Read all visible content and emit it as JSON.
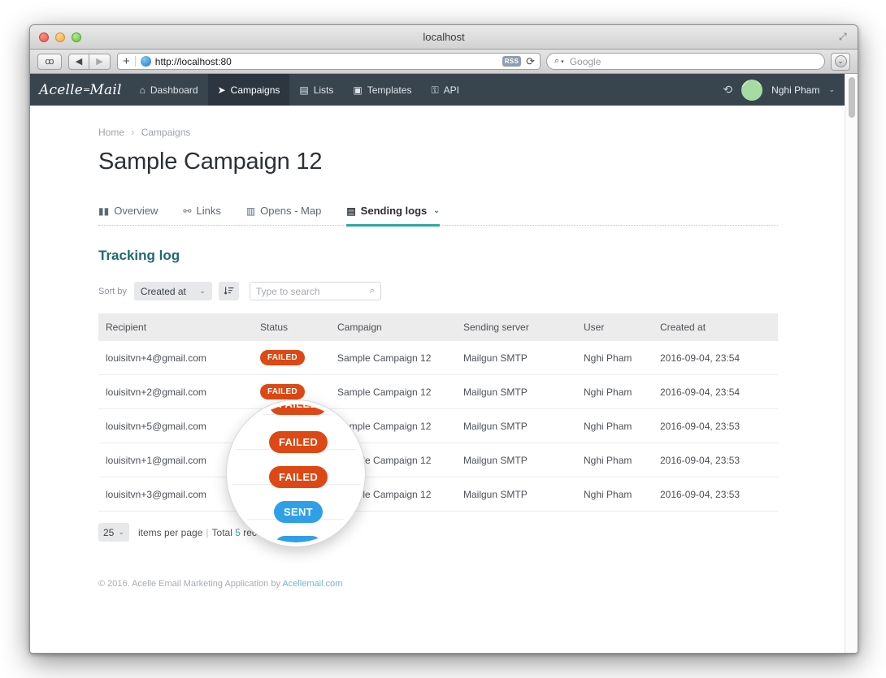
{
  "window": {
    "title": "localhost",
    "fullscreen_icon": "expand-icon",
    "traffic_lights": [
      "close",
      "minimize",
      "maximize"
    ]
  },
  "browser": {
    "sidebar_icon": "glasses-icon",
    "back_icon": "◀",
    "forward_icon": "▶",
    "new_tab_label": "+",
    "site_icon": "globe-icon",
    "url": "http://localhost:80",
    "rss_label": "RSS",
    "reload_icon": "⟳",
    "search_icon": "search-icon",
    "search_caret": "▾",
    "search_placeholder": "Google",
    "downloads_icon": "download-icon"
  },
  "navbar": {
    "brand_left": "Acelle",
    "brand_eq": "=",
    "brand_right": "Mail",
    "items": [
      {
        "label": "Dashboard",
        "icon": "⌂",
        "icon_name": "home-icon",
        "active": false
      },
      {
        "label": "Campaigns",
        "icon": "➤",
        "icon_name": "paper-plane-icon",
        "active": true
      },
      {
        "label": "Lists",
        "icon": "▤",
        "icon_name": "address-book-icon",
        "active": false
      },
      {
        "label": "Templates",
        "icon": "▣",
        "icon_name": "template-icon",
        "active": false
      },
      {
        "label": "API",
        "icon": "⚿",
        "icon_name": "key-icon",
        "active": false
      }
    ],
    "history_icon": "⟲",
    "username": "Nghi Pham",
    "user_caret": "⌄"
  },
  "breadcrumb": {
    "home": "Home",
    "separator": "›",
    "current": "Campaigns"
  },
  "page": {
    "title": "Sample Campaign 12"
  },
  "tabs": [
    {
      "label": "Overview",
      "icon": "▮▮",
      "icon_name": "bar-chart-icon",
      "active": false,
      "caret": ""
    },
    {
      "label": "Links",
      "icon": "⚯",
      "icon_name": "link-icon",
      "active": false,
      "caret": ""
    },
    {
      "label": "Opens - Map",
      "icon": "▥",
      "icon_name": "map-icon",
      "active": false,
      "caret": ""
    },
    {
      "label": "Sending logs",
      "icon": "▤",
      "icon_name": "file-icon",
      "active": true,
      "caret": "⌄"
    }
  ],
  "section": {
    "title": "Tracking log"
  },
  "controls": {
    "sort_by_label": "Sort by",
    "sort_value": "Created at",
    "sort_caret": "⌄",
    "sort_direction_icon": "sort-descending-icon",
    "sort_direction_glyph": "↓≡",
    "search_placeholder": "Type to search",
    "search_value": "",
    "search_icon_glyph": "⌕"
  },
  "table": {
    "columns": [
      "Recipient",
      "Status",
      "Campaign",
      "Sending server",
      "User",
      "Created at"
    ],
    "rows": [
      {
        "recipient": "louisitvn+4@gmail.com",
        "status": "FAILED",
        "status_kind": "failed",
        "campaign": "Sample Campaign 12",
        "server": "Mailgun SMTP",
        "user": "Nghi Pham",
        "created_at": "2016-09-04, 23:54"
      },
      {
        "recipient": "louisitvn+2@gmail.com",
        "status": "FAILED",
        "status_kind": "failed",
        "campaign": "Sample Campaign 12",
        "server": "Mailgun SMTP",
        "user": "Nghi Pham",
        "created_at": "2016-09-04, 23:54"
      },
      {
        "recipient": "louisitvn+5@gmail.com",
        "status": "FAILED",
        "status_kind": "failed",
        "campaign": "Sample Campaign 12",
        "server": "Mailgun SMTP",
        "user": "Nghi Pham",
        "created_at": "2016-09-04, 23:53"
      },
      {
        "recipient": "louisitvn+1@gmail.com",
        "status": "SENT",
        "status_kind": "sent",
        "campaign": "Sample Campaign 12",
        "server": "Mailgun SMTP",
        "user": "Nghi Pham",
        "created_at": "2016-09-04, 23:53"
      },
      {
        "recipient": "louisitvn+3@gmail.com",
        "status": "SENT",
        "status_kind": "sent",
        "campaign": "Sample Campaign 12",
        "server": "Mailgun SMTP",
        "user": "Nghi Pham",
        "created_at": "2016-09-04, 23:53"
      }
    ]
  },
  "magnifier": {
    "badges": [
      {
        "label": "FAILED",
        "kind": "failed"
      },
      {
        "label": "FAILED",
        "kind": "failed"
      },
      {
        "label": "FAILED",
        "kind": "failed"
      },
      {
        "label": "SENT",
        "kind": "sent"
      },
      {
        "label": "SENT",
        "kind": "sent"
      }
    ]
  },
  "pagination": {
    "per_page": "25",
    "caret": "⌄",
    "items_per_page_label": "items per page",
    "pipe": "|",
    "total_prefix": "Total",
    "total_count": "5",
    "total_suffix": "records"
  },
  "footer": {
    "text": "© 2016. Acelle Email Marketing Application by ",
    "link": "Acellemail.com"
  },
  "colors": {
    "navbar_bg": "#38454f",
    "navbar_active": "#2b3640",
    "accent_teal": "#2cab9a",
    "section_title": "#1f6a6b",
    "badge_failed": "#dd4814",
    "badge_sent": "#2fa0e8",
    "avatar": "#a6dca4"
  }
}
